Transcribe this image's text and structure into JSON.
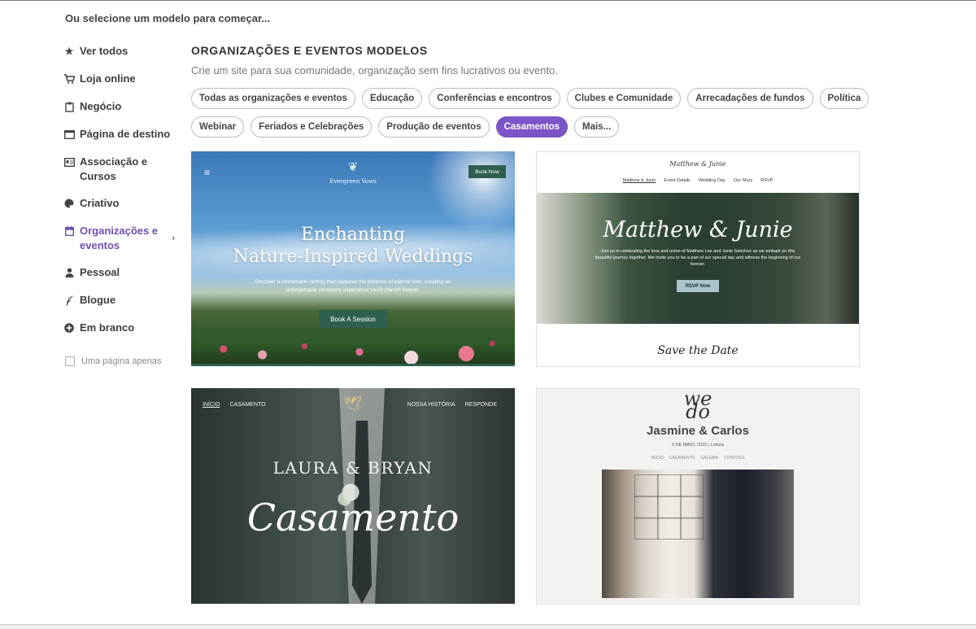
{
  "intro_text": "Ou selecione um modelo para começar...",
  "sidebar": {
    "items": [
      {
        "label": "Ver todos",
        "icon": "star-icon"
      },
      {
        "label": "Loja online",
        "icon": "cart-icon"
      },
      {
        "label": "Negócio",
        "icon": "clipboard-icon"
      },
      {
        "label": "Página de destino",
        "icon": "browser-window-icon"
      },
      {
        "label": "Associação e Cursos",
        "icon": "id-card-icon"
      },
      {
        "label": "Criativo",
        "icon": "palette-icon"
      },
      {
        "label": "Organizações e eventos",
        "icon": "calendar-icon",
        "active": true
      },
      {
        "label": "Pessoal",
        "icon": "person-icon"
      },
      {
        "label": "Blogue",
        "icon": "quill-icon"
      },
      {
        "label": "Em branco",
        "icon": "plus-circle-icon"
      }
    ],
    "single_page_label": "Uma página apenas",
    "single_page_checked": false
  },
  "main": {
    "title": "ORGANIZAÇÕES E EVENTOS MODELOS",
    "subtitle": "Crie um site para sua comunidade, organização sem fins lucrativos ou evento.",
    "chips_row1": [
      "Todas as organizações e eventos",
      "Educação",
      "Conferências e encontros",
      "Clubes e Comunidade",
      "Arrecadações de fundos",
      "Política"
    ],
    "chips_row2": [
      "Webinar",
      "Feriados e Celebrações",
      "Produção de eventos",
      "Casamentos",
      "Mais..."
    ],
    "active_chip": "Casamentos",
    "accent_color": "#7c55c7"
  },
  "templates": {
    "card1": {
      "brand": "Evergreen Vows",
      "book_now": "Book Now",
      "title_line1": "Enchanting",
      "title_line2": "Nature-Inspired Weddings",
      "description": "Discover a remarkable setting that captures the essence of eternal love, creating an unforgettable ceremony experience you'll cherish forever.",
      "cta": "Book A Session"
    },
    "card2": {
      "script_header": "Matthew & Junie",
      "nav": [
        "Matthew & Junie",
        "Event Details",
        "Wedding Day",
        "Our Story",
        "RSVP"
      ],
      "hero_title": "Matthew & Junie",
      "hero_desc": "Join us in celebrating the love and union of Matthew Lee and Junie Sanchez as we embark on this beautiful journey together. We invite you to be a part of our special day and witness the beginning of our forever.",
      "rsvp": "RSVP Now",
      "save_the_date": "Save the Date"
    },
    "card3": {
      "nav_left": [
        "INÍCIO",
        "CASAMENTO"
      ],
      "nav_right": [
        "NOSSA HISTÓRIA",
        "RESPONDE"
      ],
      "names": "LAURA & BRYAN",
      "script": "Casamento"
    },
    "card4": {
      "monogram_top": "we",
      "monogram_bottom": "do",
      "names": "Jasmine & Carlos",
      "date": "9 DE MAIO, 2022 | Lisboa",
      "nav": [
        "INÍCIO",
        "CASAMENTO",
        "GALERIA",
        "CONVITES"
      ]
    }
  }
}
